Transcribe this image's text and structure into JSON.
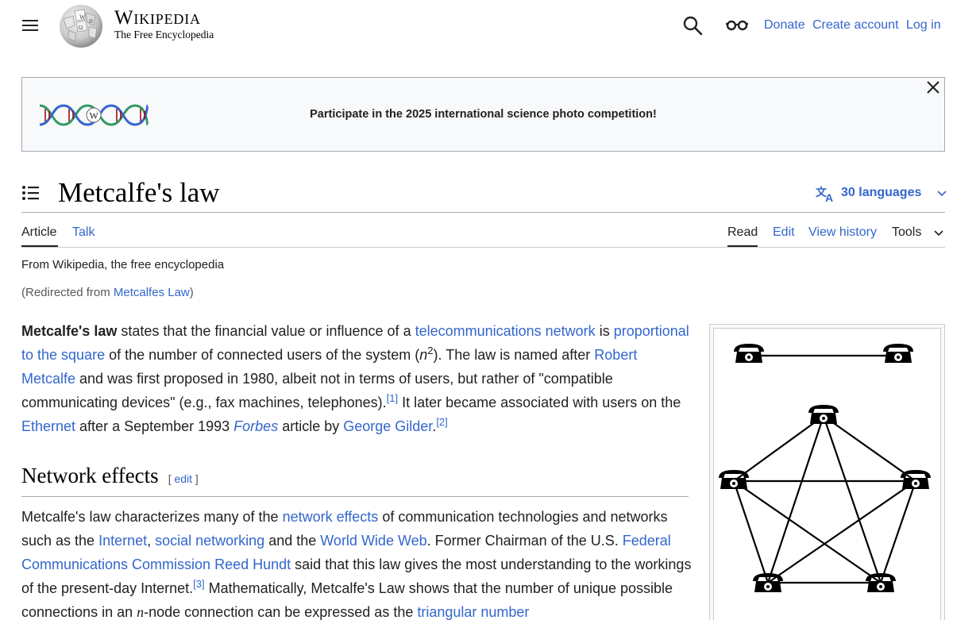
{
  "header": {
    "wordmark": "Wikipedia",
    "tagline": "The Free Encyclopedia",
    "donate": "Donate",
    "create_account": "Create account",
    "log_in": "Log in"
  },
  "banner": {
    "text": "Participate in the 2025 international science photo competition!",
    "logo_letter": "W"
  },
  "page": {
    "title": "Metcalfe's law",
    "languages": "30 languages"
  },
  "tabs": {
    "article": "Article",
    "talk": "Talk",
    "read": "Read",
    "edit": "Edit",
    "view_history": "View history",
    "tools": "Tools"
  },
  "meta": {
    "from": "From Wikipedia, the free encyclopedia",
    "redirect_open": "(Redirected from ",
    "redirect_link": "Metcalfes Law",
    "redirect_close": ")"
  },
  "lead": {
    "bold": "Metcalfe's law",
    "t1": " states that the financial value or influence of a ",
    "l1": "telecommunications network",
    "t2": " is ",
    "l2": "proportional to the square",
    "t3": " of the number of connected users of the system (",
    "n": "n",
    "exp": "2",
    "t4": "). The law is named after ",
    "l3": "Robert Metcalfe",
    "t5": " and was first proposed in 1980, albeit not in terms of users, but rather of \"compatible communicating devices\" (e.g., fax machines, telephones).",
    "ref1": "[1]",
    "t6": " It later became associated with users on the ",
    "l4": "Ethernet",
    "t7": " after a September 1993 ",
    "forbes": "Forbes",
    "t8": " article by ",
    "l5": "George Gilder",
    "t9": ".",
    "ref2": "[2]"
  },
  "section": {
    "title": "Network effects",
    "edit_open": "[ ",
    "edit": "edit",
    "edit_close": " ]"
  },
  "para2": {
    "t1": "Metcalfe's law characterizes many of the ",
    "l1": "network effects",
    "t2": " of communication technologies and networks such as the ",
    "l2": "Internet",
    "t3": ", ",
    "l3": "social networking",
    "t4": " and the ",
    "l4": "World Wide Web",
    "t5": ". Former Chairman of the U.S. ",
    "l5": "Federal Communications Commission",
    "t6": " ",
    "l6": "Reed Hundt",
    "t7": " said that this law gives the most understanding to the workings of the present-day Internet.",
    "ref3": "[3]",
    "t8": " Mathematically, Metcalfe's Law shows that the number of unique possible connections in an ",
    "n": "n",
    "t9": "-node connection can be expressed as the ",
    "l7": "triangular number"
  },
  "figure": {
    "description": "telephone network"
  }
}
